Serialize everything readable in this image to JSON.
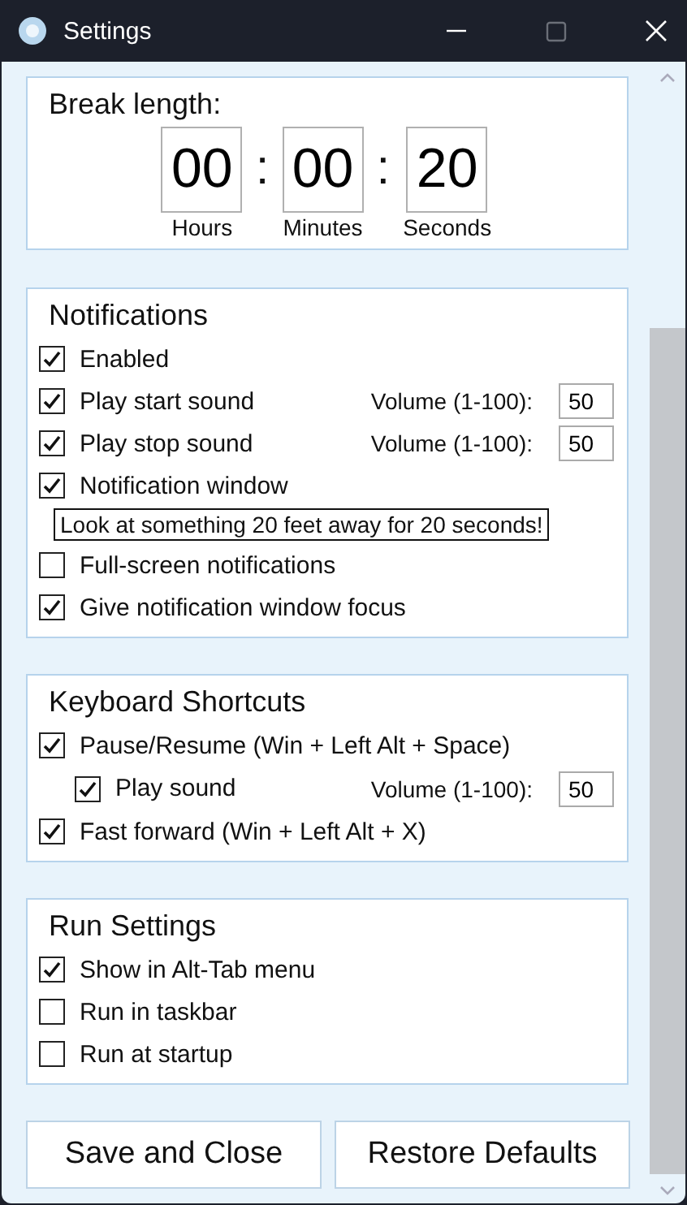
{
  "window": {
    "title": "Settings"
  },
  "break_length": {
    "title": "Break length:",
    "fields": [
      {
        "value": "00",
        "label": "Hours"
      },
      {
        "value": "00",
        "label": "Minutes"
      },
      {
        "value": "20",
        "label": "Seconds"
      }
    ],
    "separators": [
      ":",
      ":"
    ]
  },
  "sections": [
    {
      "title": "Notifications",
      "items": [
        {
          "kind": "checkbox",
          "label": "Enabled",
          "checked": true
        },
        {
          "kind": "checkbox",
          "label": "Play start sound",
          "checked": true,
          "volume_label": "Volume (1-100):",
          "volume": "50"
        },
        {
          "kind": "checkbox",
          "label": "Play stop sound",
          "checked": true,
          "volume_label": "Volume (1-100):",
          "volume": "50"
        },
        {
          "kind": "checkbox",
          "label": "Notification window",
          "checked": true
        },
        {
          "kind": "message",
          "text": "Look at something 20 feet away for 20 seconds!"
        },
        {
          "kind": "checkbox",
          "label": "Full-screen notifications",
          "checked": false
        },
        {
          "kind": "checkbox",
          "label": "Give notification window focus",
          "checked": true
        }
      ]
    },
    {
      "title": "Keyboard Shortcuts",
      "items": [
        {
          "kind": "checkbox",
          "label": "Pause/Resume (Win + Left Alt + Space)",
          "checked": true,
          "children": [
            {
              "kind": "checkbox",
              "label": "Play sound",
              "checked": true,
              "volume_label": "Volume (1-100):",
              "volume": "50"
            }
          ]
        },
        {
          "kind": "checkbox",
          "label": "Fast forward (Win + Left Alt + X)",
          "checked": true
        }
      ]
    },
    {
      "title": "Run Settings",
      "items": [
        {
          "kind": "checkbox",
          "label": "Show in Alt-Tab menu",
          "checked": true
        },
        {
          "kind": "checkbox",
          "label": "Run in taskbar",
          "checked": false
        },
        {
          "kind": "checkbox",
          "label": "Run at startup",
          "checked": false
        }
      ]
    }
  ],
  "buttons": [
    "Save and Close",
    "Restore Defaults"
  ]
}
